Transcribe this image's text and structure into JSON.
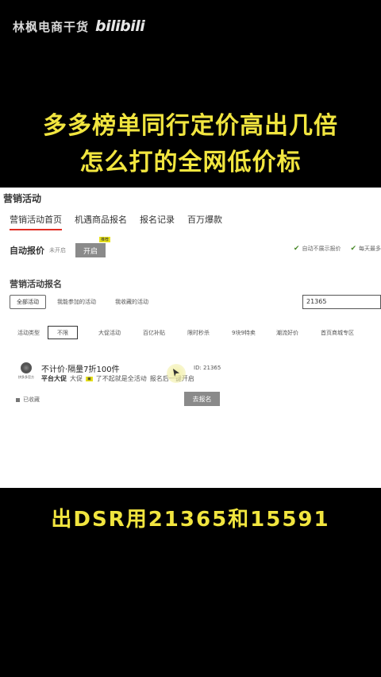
{
  "watermark": {
    "text": "林枫电商干货",
    "logo": "bilibili"
  },
  "headline": {
    "line1": "多多榜单同行定价高出几倍",
    "line2": "怎么打的全网低价标"
  },
  "screen": {
    "title": "营销活动",
    "tabs": [
      "营销活动首页",
      "机遇商品报名",
      "报名记录",
      "百万爆款"
    ],
    "auto_price": {
      "label": "自动报价",
      "status": "未开启",
      "button": "开启",
      "badge": "推荐"
    },
    "checks": [
      "自动不展示报价",
      "每天最多"
    ],
    "section_title": "营销活动报名",
    "filters": {
      "all": "全部活动",
      "joined": "我能参加的活动",
      "collected": "我收藏的活动"
    },
    "search_value": "21365",
    "types": {
      "label": "活动类型",
      "selected": "不限",
      "options": [
        "大促活动",
        "百亿补贴",
        "限时秒杀",
        "9块9特卖",
        "潮流好价",
        "首页商城专区"
      ]
    },
    "item": {
      "thumb_caption": "拼多多官方",
      "title": "不计价·隔量7折100件",
      "sub_label": "平台大促",
      "sub_tag": "大促",
      "sub_text1": "了不起就是全活动",
      "sub_text2": "报名后一键开启",
      "id": "ID: 21365"
    },
    "collected_label": "已收藏",
    "enroll_button": "去报名"
  },
  "caption": "出DSR用21365和15591",
  "colors": {
    "headline": "#f1e53f",
    "accent": "#e02e24"
  }
}
